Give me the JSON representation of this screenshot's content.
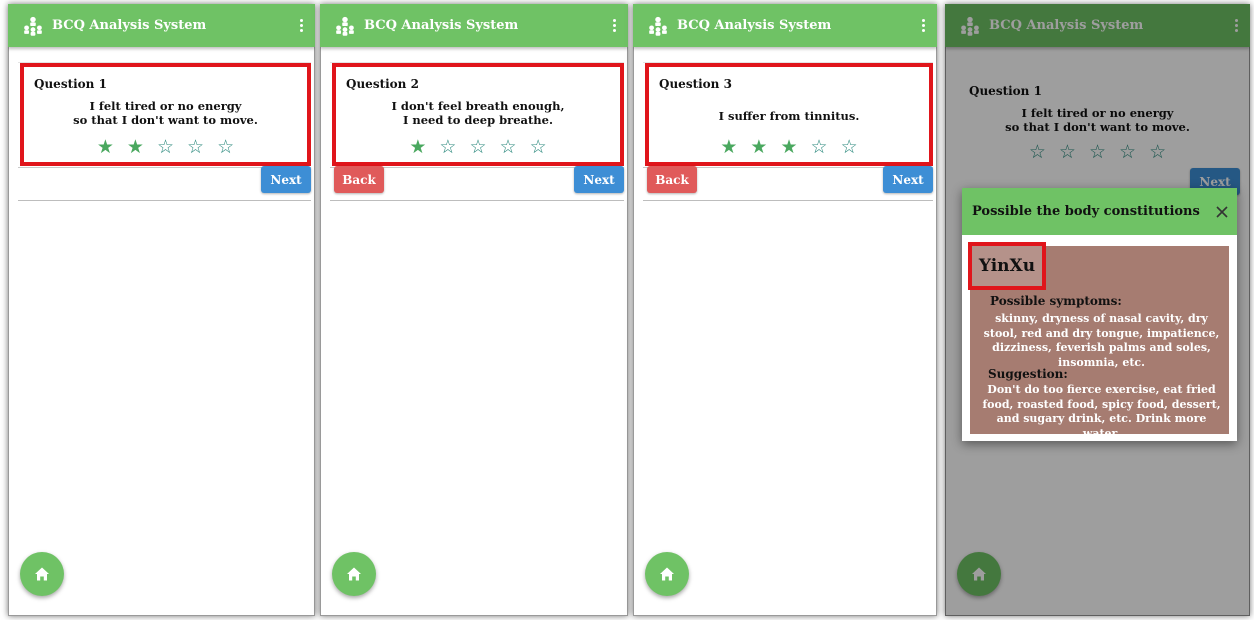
{
  "app": {
    "title": "BCQ Analysis System",
    "accent_color": "#6fc265",
    "icons": {
      "logo": "hierarchy-people-icon",
      "menu": "kebab-menu-icon",
      "home": "home-icon",
      "star": "star-icon",
      "close": "close-icon"
    }
  },
  "buttons": {
    "next": "Next",
    "back": "Back"
  },
  "screens": [
    {
      "question_label": "Question 1",
      "question_lines": [
        "I felt tired or no energy",
        "so that I don't want to move."
      ],
      "rating": 2,
      "max_rating": 5
    },
    {
      "question_label": "Question 2",
      "question_lines": [
        "I don't feel breath enough,",
        "I need to deep breathe."
      ],
      "rating": 1,
      "max_rating": 5
    },
    {
      "question_label": "Question 3",
      "question_lines": [
        "I suffer from tinnitus."
      ],
      "rating": 3,
      "max_rating": 5
    }
  ],
  "result_dialog": {
    "title": "Possible the body constitutions",
    "constitution": "YinXu",
    "symptoms_label": "Possible symptoms:",
    "symptoms_text": "skinny, dryness of nasal cavity, dry stool, red and dry tongue, impatience, dizziness, feverish palms and soles, insomnia, etc.",
    "suggestion_label": "Suggestion:",
    "suggestion_text": "Don't do too fierce exercise, eat fried food, roasted food, spicy food, dessert, and sugary drink, etc. Drink more water."
  }
}
